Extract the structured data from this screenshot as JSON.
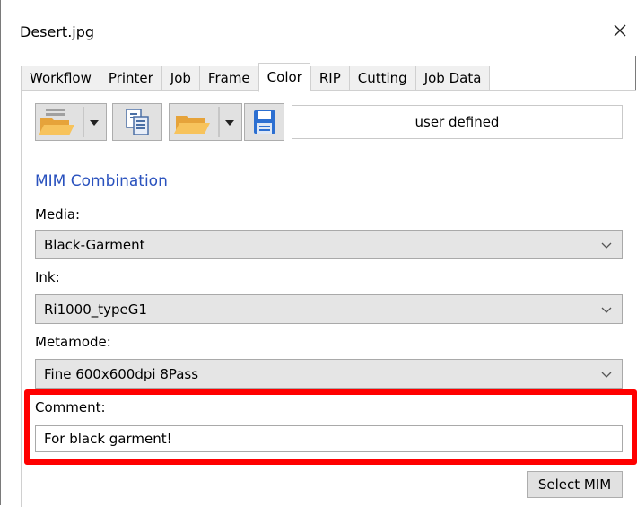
{
  "window": {
    "title": "Desert.jpg"
  },
  "tabs": [
    {
      "label": "Workflow"
    },
    {
      "label": "Printer"
    },
    {
      "label": "Job"
    },
    {
      "label": "Frame"
    },
    {
      "label": "Color"
    },
    {
      "label": "RIP"
    },
    {
      "label": "Cutting"
    },
    {
      "label": "Job Data"
    }
  ],
  "active_tab": "Color",
  "toolbar": {
    "icons": [
      "open-folder-dropdown-icon",
      "copy-documents-icon",
      "open-folder-dropdown-icon",
      "save-floppy-icon"
    ],
    "preset_value": "user defined"
  },
  "mim": {
    "section_title": "MIM Combination",
    "media_label": "Media:",
    "media_value": "Black-Garment",
    "ink_label": "Ink:",
    "ink_value": "Ri1000_typeG1",
    "metamode_label": "Metamode:",
    "metamode_value": "Fine 600x600dpi 8Pass",
    "comment_label": "Comment:",
    "comment_value": "For black garment!",
    "select_button": "Select MIM"
  },
  "colors": {
    "accent": "#2a52be",
    "highlight": "#ff0000"
  }
}
